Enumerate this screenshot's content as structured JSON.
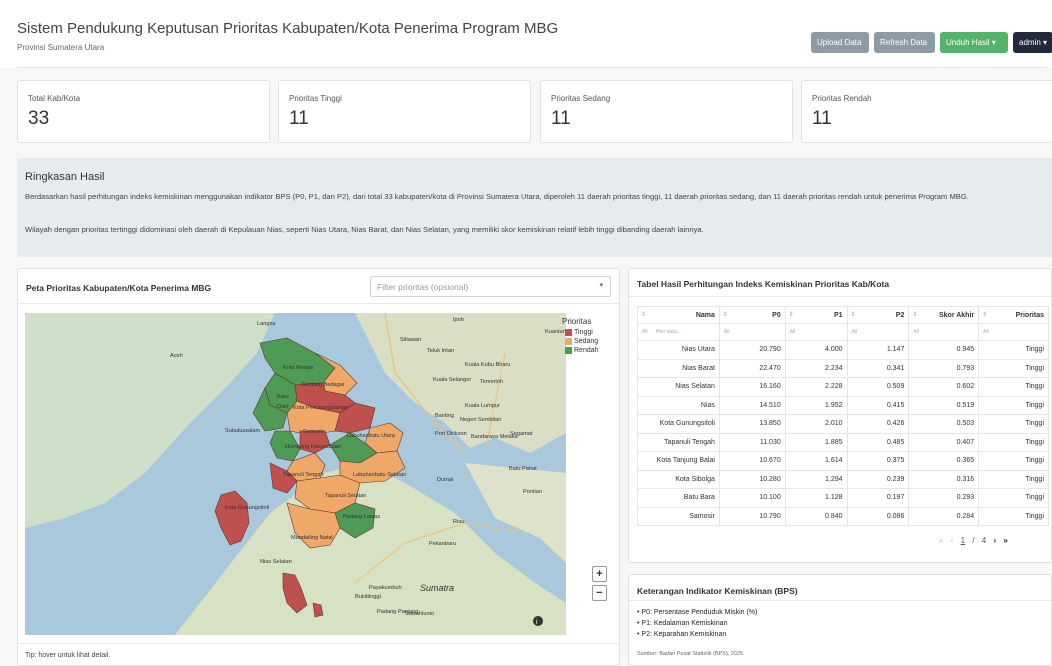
{
  "header": {
    "title": "Sistem Pendukung Keputusan Prioritas Kabupaten/Kota Penerima Program MBG",
    "subtitle": "Provinsi Sumatera Utara",
    "buttons": {
      "upload": "Upload Data",
      "refresh": "Refresh Data",
      "export": "Unduh Hasil ▾",
      "admin": "admin ▾"
    }
  },
  "stats": [
    {
      "label": "Total Kab/Kota",
      "value": "33"
    },
    {
      "label": "Prioritas Tinggi",
      "value": "11"
    },
    {
      "label": "Prioritas Sedang",
      "value": "11"
    },
    {
      "label": "Prioritas Rendah",
      "value": "11"
    }
  ],
  "summary": {
    "title": "Ringkasan Hasil",
    "p1": "Berdasarkan hasil perhitungan indeks kemiskinan menggunakan indikator BPS (P0, P1, dan P2), dari total 33 kabupaten/kota di Provinsi Sumatera Utara, diperoleh 11 daerah prioritas tinggi, 11 daerah prioritas sedang, dan 11 daerah prioritas rendah untuk penerima Program MBG.",
    "p2": "Wilayah dengan prioritas tertinggi didominasi oleh daerah di Kepulauan Nias, seperti Nias Utara, Nias Barat, dan Nias Selatan, yang memiliki skor kemiskinan relatif lebih tinggi dibanding daerah lainnya."
  },
  "map": {
    "title": "Peta Prioritas Kabupaten/Kota Penerima MBG",
    "filter_placeholder": "Filter prioritas (opsional)",
    "legend_title": "Prioritas",
    "legend": [
      {
        "label": "Tinggi",
        "color": "#c0504d"
      },
      {
        "label": "Sedang",
        "color": "#f0a868"
      },
      {
        "label": "Rendah",
        "color": "#4f9a55"
      }
    ],
    "zoom_in": "+",
    "zoom_out": "−",
    "tip": "Tip: hover untuk lihat detail.",
    "labels": [
      "Langsa",
      "Ipoh",
      "Sitiawan",
      "Teluk Intan",
      "Kuala Kubu Bharu",
      "Kuantan",
      "Aceh",
      "Kuala Selangor",
      "Temerloh",
      "Kota Medan",
      "Serdang Bedagai",
      "Karo",
      "Dairi",
      "Kota Pematangsiantar",
      "Kuala Lumpur",
      "Banting",
      "Negeri Sembilan",
      "Subulussalam",
      "Samosir",
      "Labuhanbatu Utara",
      "Port Dickson",
      "Bandaraya Melaka",
      "Segamat",
      "Humbang Hasundutan",
      "Batu Pahat",
      "Tapanuli Tengah",
      "Labuhanbatu Selatan",
      "Dumai",
      "Pontian",
      "Kota Gunungsitoli",
      "Tapanuli Selatan",
      "Padang Lawas",
      "Riau",
      "Mandailing Natal",
      "Pekanbaru",
      "Nias Selatan",
      "Payakumbuh",
      "Sumatra",
      "Bukittinggi",
      "Padang Panjang",
      "Sawahlunto"
    ]
  },
  "table": {
    "title": "Tabel Hasil Perhitungan Indeks Kemiskinan Prioritas Kab/Kota",
    "columns": [
      "Nama",
      "P0",
      "P1",
      "P2",
      "Skor Akhir",
      "Prioritas"
    ],
    "filter_placeholders": [
      "All",
      "filter data...",
      "All",
      "All",
      "All",
      "All",
      "All"
    ],
    "rows": [
      [
        "Nias Utara",
        "20.790",
        "4.000",
        "1.147",
        "0.945",
        "Tinggi"
      ],
      [
        "Nias Barat",
        "22.470",
        "2.234",
        "0.341",
        "0.793",
        "Tinggi"
      ],
      [
        "Nias Selatan",
        "16.160",
        "2.228",
        "0.509",
        "0.602",
        "Tinggi"
      ],
      [
        "Nias",
        "14.510",
        "1.952",
        "0.415",
        "0.519",
        "Tinggi"
      ],
      [
        "Kota Gunungsitoli",
        "13.850",
        "2.010",
        "0.426",
        "0.503",
        "Tinggi"
      ],
      [
        "Tapanuli Tengah",
        "11.030",
        "1.885",
        "0.485",
        "0.407",
        "Tinggi"
      ],
      [
        "Kota Tanjung Balai",
        "10.670",
        "1.614",
        "0.375",
        "0.365",
        "Tinggi"
      ],
      [
        "Kota Sibolga",
        "10.280",
        "1.294",
        "0.239",
        "0.316",
        "Tinggi"
      ],
      [
        "Batu Bara",
        "10.100",
        "1.128",
        "0.197",
        "0.293",
        "Tinggi"
      ],
      [
        "Samosir",
        "10.790",
        "0.840",
        "0.086",
        "0.284",
        "Tinggi"
      ]
    ],
    "pager": {
      "first": "«",
      "prev": "‹",
      "page": "1",
      "sep": "/",
      "total": "4",
      "next": "›",
      "last": "»"
    }
  },
  "indicators": {
    "title": "Keterangan Indikator Kemiskinan (BPS)",
    "items": [
      "P0: Persentase Penduduk Miskin (%)",
      "P1: Kedalaman Kemiskinan",
      "P2: Keparahan Kemiskinan"
    ],
    "source": "Sumber: Badan Pusat Statistik (BPS), 2025"
  }
}
